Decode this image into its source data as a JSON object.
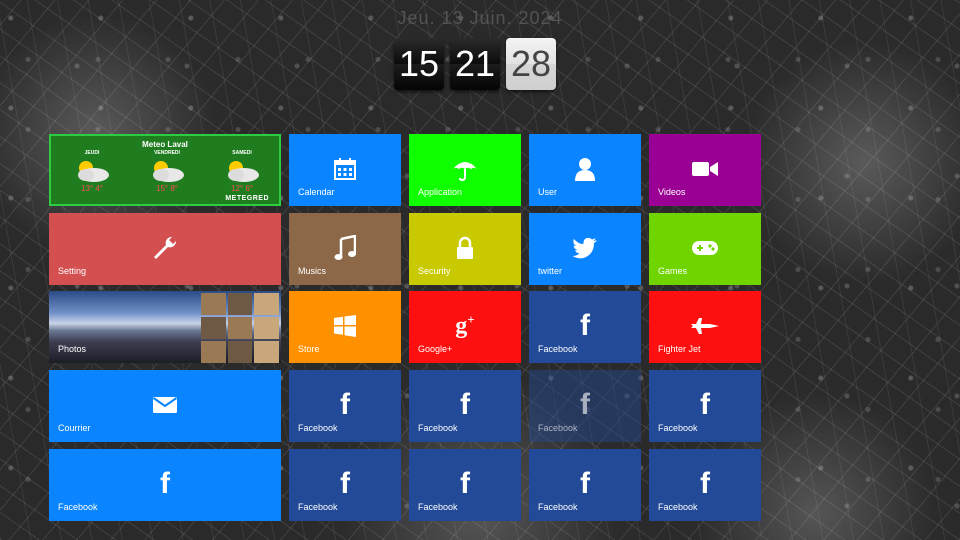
{
  "date": "Jeu. 13 Juin. 2024",
  "clock": {
    "hours": "15",
    "minutes": "21",
    "seconds": "28"
  },
  "weather": {
    "title": "Meteo Laval",
    "days": [
      {
        "name": "JEUDI",
        "temp": "13° 4°"
      },
      {
        "name": "VENDREDI",
        "temp": "15° 8°"
      },
      {
        "name": "SAMEDI",
        "temp": "12° 6°"
      }
    ],
    "brand": "METEGRED"
  },
  "tiles": {
    "calendar": {
      "label": "Calendar",
      "color": "#0a84ff",
      "icon": "calendar-icon"
    },
    "application": {
      "label": "Application",
      "color": "#10ff00",
      "icon": "umbrella-icon"
    },
    "user": {
      "label": "User",
      "color": "#0a84ff",
      "icon": "user-icon"
    },
    "videos": {
      "label": "Videos",
      "color": "#9b0094",
      "icon": "video-camera-icon"
    },
    "setting": {
      "label": "Setting",
      "color": "#d45050",
      "icon": "wrench-icon"
    },
    "musics": {
      "label": "Musics",
      "color": "#8c6848",
      "icon": "music-icon"
    },
    "security": {
      "label": "Security",
      "color": "#c9c900",
      "icon": "lock-icon"
    },
    "twitter": {
      "label": "twitter",
      "color": "#0a84ff",
      "icon": "twitter-icon"
    },
    "games": {
      "label": "Games",
      "color": "#70d400",
      "icon": "gamepad-icon"
    },
    "photos": {
      "label": "Photos",
      "icon": "photos-icon"
    },
    "store": {
      "label": "Store",
      "color": "#ff9100",
      "icon": "windows-icon"
    },
    "googleplus": {
      "label": "Google+",
      "color": "#ff1010",
      "icon": "google-plus-icon"
    },
    "facebook_r3": {
      "label": "Facebook",
      "color": "#224a98",
      "icon": "facebook-icon"
    },
    "fighter_jet": {
      "label": "Fighter Jet",
      "color": "#ff1010",
      "icon": "fighter-jet-icon"
    },
    "courrier": {
      "label": "Courrier",
      "color": "#0a84ff",
      "icon": "envelope-icon"
    },
    "facebook_r4_1": {
      "label": "Facebook",
      "color": "#224a98",
      "icon": "facebook-icon"
    },
    "facebook_r4_2": {
      "label": "Facebook",
      "color": "#224a98",
      "icon": "facebook-icon"
    },
    "facebook_r4_3": {
      "label": "Facebook",
      "color": "#224a98",
      "icon": "facebook-icon"
    },
    "facebook_r4_4": {
      "label": "Facebook",
      "color": "#224a98",
      "icon": "facebook-icon"
    },
    "facebook_r5_wide": {
      "label": "Facebook",
      "color": "#0a84ff",
      "icon": "facebook-icon"
    },
    "facebook_r5_1": {
      "label": "Facebook",
      "color": "#224a98",
      "icon": "facebook-icon"
    },
    "facebook_r5_2": {
      "label": "Facebook",
      "color": "#224a98",
      "icon": "facebook-icon"
    },
    "facebook_r5_3": {
      "label": "Facebook",
      "color": "#224a98",
      "icon": "facebook-icon"
    },
    "facebook_r5_4": {
      "label": "Facebook",
      "color": "#224a98",
      "icon": "facebook-icon"
    }
  }
}
